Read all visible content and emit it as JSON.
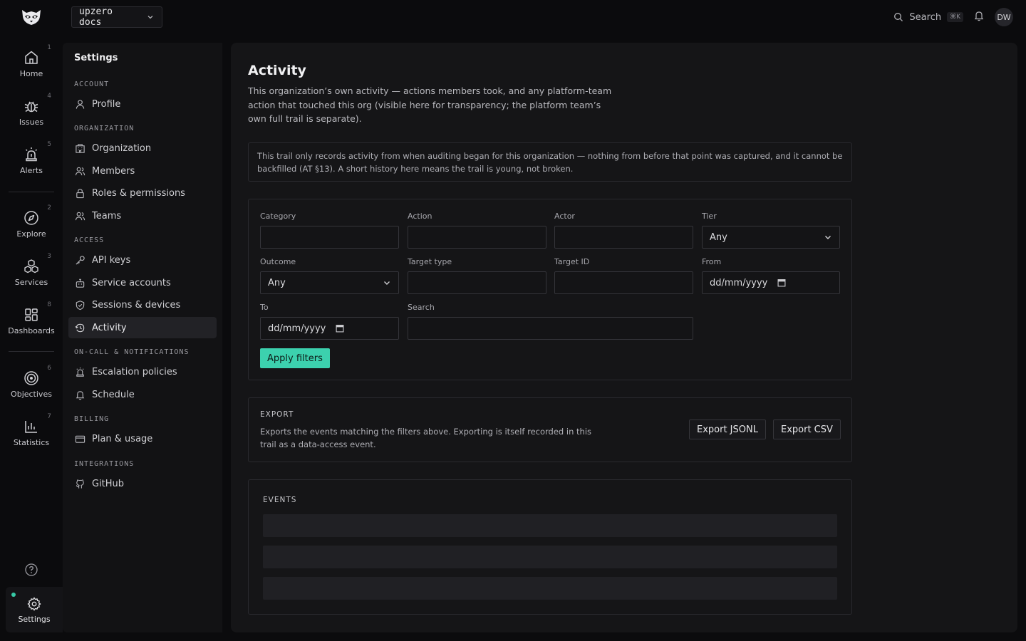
{
  "topbar": {
    "project": "upzero docs",
    "search_label": "Search",
    "search_shortcut": "⌘K",
    "avatar_initials": "DW"
  },
  "rail": {
    "items": [
      {
        "label": "Home",
        "num": "1",
        "icon": "home-icon"
      },
      {
        "label": "Issues",
        "num": "4",
        "icon": "bug-icon"
      },
      {
        "label": "Alerts",
        "num": "5",
        "icon": "siren-icon"
      },
      {
        "label": "Explore",
        "num": "2",
        "icon": "compass-icon"
      },
      {
        "label": "Services",
        "num": "3",
        "icon": "cubes-icon"
      },
      {
        "label": "Dashboards",
        "num": "8",
        "icon": "grid-icon"
      },
      {
        "label": "Objectives",
        "num": "6",
        "icon": "target-icon"
      },
      {
        "label": "Statistics",
        "num": "7",
        "icon": "bar-chart-icon"
      }
    ],
    "settings_label": "Settings",
    "status_color": "#37c9a6"
  },
  "settings_nav": {
    "title": "Settings",
    "sections": {
      "account": "ACCOUNT",
      "organization": "ORGANIZATION",
      "access": "ACCESS",
      "oncall": "ON-CALL & NOTIFICATIONS",
      "billing": "BILLING",
      "integrations": "INTEGRATIONS"
    },
    "items": {
      "profile": "Profile",
      "organization": "Organization",
      "members": "Members",
      "roles": "Roles & permissions",
      "teams": "Teams",
      "api_keys": "API keys",
      "service_accounts": "Service accounts",
      "sessions": "Sessions & devices",
      "activity": "Activity",
      "escalation": "Escalation policies",
      "schedule": "Schedule",
      "plan": "Plan & usage",
      "github": "GitHub"
    }
  },
  "main": {
    "title": "Activity",
    "description": "This organization’s own activity — actions members took, and any platform-team action that touched this org (visible here for transparency; the platform team’s own full trail is separate).",
    "notice": "This trail only records activity from when auditing began for this organization — nothing from before that point was captured, and it cannot be backfilled (AT §13). A short history here means the trail is young, not broken.",
    "filters": {
      "category_label": "Category",
      "action_label": "Action",
      "actor_label": "Actor",
      "tier_label": "Tier",
      "tier_value": "Any",
      "outcome_label": "Outcome",
      "outcome_value": "Any",
      "target_type_label": "Target type",
      "target_id_label": "Target ID",
      "from_label": "From",
      "from_placeholder": "dd/mm/yyyy",
      "to_label": "To",
      "to_placeholder": "dd/mm/yyyy",
      "search_label": "Search",
      "apply_label": "Apply filters",
      "accent": "#3cd1ae"
    },
    "export": {
      "heading": "EXPORT",
      "description": "Exports the events matching the filters above. Exporting is itself recorded in this trail as a data-access event.",
      "jsonl_label": "Export JSONL",
      "csv_label": "Export CSV"
    },
    "events": {
      "heading": "EVENTS"
    }
  }
}
